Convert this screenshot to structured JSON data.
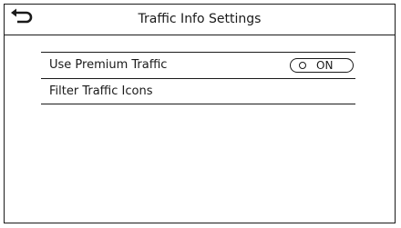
{
  "header": {
    "title": "Traffic Info Settings",
    "back_icon": "back-return-arrow-icon"
  },
  "settings": [
    {
      "label": "Use Premium Traffic",
      "toggle": {
        "state_label": "ON",
        "on": true
      }
    },
    {
      "label": "Filter Traffic Icons"
    }
  ],
  "colors": {
    "line": "#1a1a1a",
    "background": "#ffffff"
  }
}
